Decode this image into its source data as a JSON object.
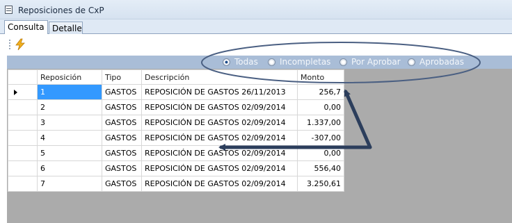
{
  "window": {
    "title": "Reposiciones de CxP",
    "icon": "calculator-icon"
  },
  "tabs": [
    {
      "label": "Consulta",
      "active": true
    },
    {
      "label": "Detalle",
      "active": false
    }
  ],
  "toolbar": {
    "action_icon": "lightning-bolt-icon"
  },
  "filters": {
    "options": [
      "Todas",
      "Incompletas",
      "Por Aprobar",
      "Aprobadas"
    ],
    "selected": "Todas"
  },
  "grid": {
    "columns": [
      "Reposición",
      "Tipo",
      "Descripción",
      "Monto"
    ],
    "rows": [
      {
        "reposicion": "1",
        "tipo": "GASTOS",
        "descripcion": "REPOSICIÓN DE GASTOS 26/11/2013",
        "monto": "256,7"
      },
      {
        "reposicion": "2",
        "tipo": "GASTOS",
        "descripcion": "REPOSICIÓN DE GASTOS 02/09/2014",
        "monto": "0,00"
      },
      {
        "reposicion": "3",
        "tipo": "GASTOS",
        "descripcion": "REPOSICIÓN DE GASTOS 02/09/2014",
        "monto": "1.337,00"
      },
      {
        "reposicion": "4",
        "tipo": "GASTOS",
        "descripcion": "REPOSICIÓN DE GASTOS 02/09/2014",
        "monto": "-307,00"
      },
      {
        "reposicion": "5",
        "tipo": "GASTOS",
        "descripcion": "REPOSICIÓN DE GASTOS 02/09/2014",
        "monto": "0,00"
      },
      {
        "reposicion": "6",
        "tipo": "GASTOS",
        "descripcion": "REPOSICIÓN DE GASTOS 02/09/2014",
        "monto": "556,40"
      },
      {
        "reposicion": "7",
        "tipo": "GASTOS",
        "descripcion": "REPOSICIÓN DE GASTOS 02/09/2014",
        "monto": "3.250,61"
      }
    ],
    "selected_row": 0
  },
  "annotation": {
    "stroke_color": "#2c3e5c"
  }
}
